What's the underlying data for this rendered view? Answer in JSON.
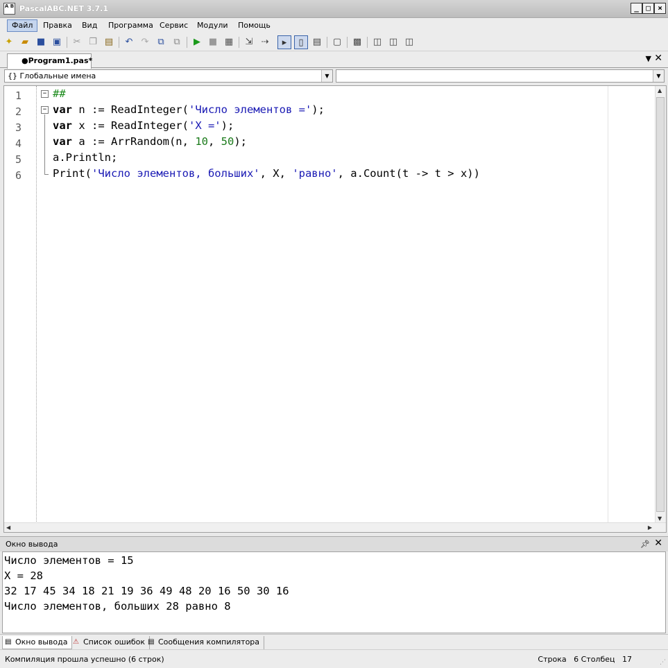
{
  "window": {
    "title": "PascalABC.NET 3.7.1",
    "icon_text": "A B"
  },
  "menu": [
    "Файл",
    "Правка",
    "Вид",
    "Программа",
    "Сервис",
    "Модули",
    "Помощь"
  ],
  "tabs": {
    "active": "●Program1.pas*"
  },
  "combos": {
    "scope": "Глобальные имена",
    "member": ""
  },
  "editor": {
    "line_numbers": [
      "1",
      "2",
      "3",
      "4",
      "5",
      "6"
    ],
    "lines": [
      [
        {
          "t": "##",
          "c": "cm"
        }
      ],
      [
        {
          "t": "var",
          "c": "kw"
        },
        {
          "t": " n := ReadInteger(",
          "c": ""
        },
        {
          "t": "'Число элементов ='",
          "c": "str"
        },
        {
          "t": ");",
          "c": ""
        }
      ],
      [
        {
          "t": "var",
          "c": "kw"
        },
        {
          "t": " x := ReadInteger(",
          "c": ""
        },
        {
          "t": "'X ='",
          "c": "str"
        },
        {
          "t": ");",
          "c": ""
        }
      ],
      [
        {
          "t": "var",
          "c": "kw"
        },
        {
          "t": " a := ArrRandom(n, ",
          "c": ""
        },
        {
          "t": "10",
          "c": "num"
        },
        {
          "t": ", ",
          "c": ""
        },
        {
          "t": "50",
          "c": "num"
        },
        {
          "t": ");",
          "c": ""
        }
      ],
      [
        {
          "t": "a.Println;",
          "c": ""
        }
      ],
      [
        {
          "t": "Print(",
          "c": ""
        },
        {
          "t": "'Число элементов, больших'",
          "c": "str"
        },
        {
          "t": ", X, ",
          "c": ""
        },
        {
          "t": "'равно'",
          "c": "str"
        },
        {
          "t": ", a.Count(t -> t > x))",
          "c": ""
        }
      ]
    ]
  },
  "output_panel": {
    "title": "Окно вывода",
    "lines": [
      "Число элементов = 15",
      "X = 28",
      "32 17 45 34 18 21 19 36 49 48 20 16 50 30 16",
      "Число элементов, больших 28 равно 8"
    ]
  },
  "bottom_tabs": [
    "Окно вывода",
    "Список ошибок",
    "Сообщения компилятора"
  ],
  "status": {
    "message": "Компиляция прошла успешно (6 строк)",
    "row_label": "Строка",
    "row": "6",
    "col_label": "Столбец",
    "col": "17"
  }
}
